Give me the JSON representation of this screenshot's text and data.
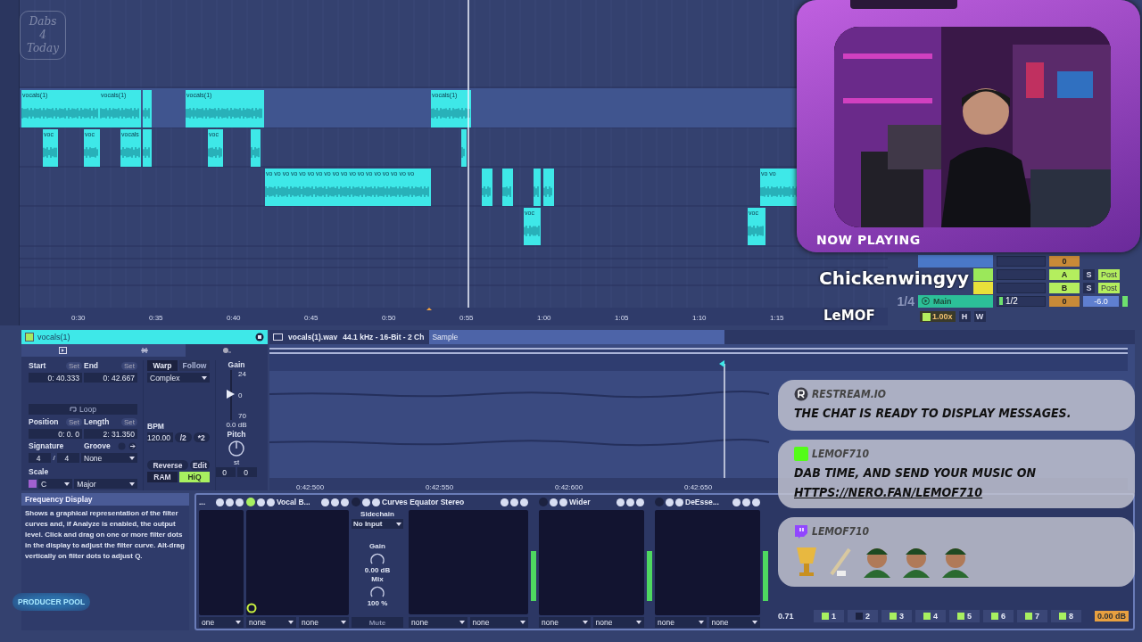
{
  "stream_logo": {
    "lines": [
      "Dabs",
      "4",
      "Today"
    ]
  },
  "arrangement": {
    "clips": [
      {
        "label": "vocals(1)"
      },
      {
        "label": "vocals(1)"
      },
      {
        "label": "vocals(1)"
      },
      {
        "label": "vocals(1)"
      },
      {
        "label": "voc"
      },
      {
        "label": "voc"
      },
      {
        "label": "vocals"
      },
      {
        "label": "voc"
      },
      {
        "label": "vo vo vo vo vo vo vo vo vo vo vo vo vo vo vo vo vo vo"
      },
      {
        "label": "vo vo"
      },
      {
        "label": "voc"
      },
      {
        "label": "voc"
      }
    ],
    "ruler": [
      "0:30",
      "0:35",
      "0:40",
      "0:45",
      "0:50",
      "0:55",
      "1:00",
      "1:05",
      "1:10",
      "1:15"
    ]
  },
  "mixer": {
    "top_value": "0",
    "sends": [
      {
        "letter": "A",
        "solo": "S",
        "mode": "Post",
        "color": "#9be85a"
      },
      {
        "letter": "B",
        "solo": "S",
        "mode": "Post",
        "color": "#e8e03a"
      }
    ],
    "main": {
      "meter": "1/4",
      "name": "Main",
      "routing": "1/2",
      "pan": "0",
      "volume": "-6.0"
    },
    "speed": {
      "value": "1.00x",
      "on": true
    },
    "buttons": [
      "H",
      "W"
    ]
  },
  "overlay": {
    "now_playing": "NOW PLAYING",
    "track": "Chickenwingyy",
    "artist": "LeMOF"
  },
  "clip": {
    "name": "vocals(1)",
    "start": {
      "label": "Start",
      "set": "Set",
      "value": "0: 40.333"
    },
    "end": {
      "label": "End",
      "set": "Set",
      "value": "0: 42.667"
    },
    "loop": {
      "label": "Loop",
      "on": false
    },
    "position": {
      "label": "Position",
      "set": "Set",
      "value": "0: 0. 0"
    },
    "length": {
      "label": "Length",
      "set": "Set",
      "value": "2: 31.350"
    },
    "signature": {
      "label": "Signature",
      "numerator": "4",
      "separator": "/",
      "denominator": "4"
    },
    "groove": {
      "label": "Groove",
      "value": "None"
    },
    "scale": {
      "label": "Scale",
      "root": "C",
      "mode": "Major"
    },
    "warp": {
      "label": "Warp",
      "on": true
    },
    "follow": {
      "label": "Follow",
      "on": false
    },
    "warp_mode": "Complex",
    "bpm": {
      "label": "BPM",
      "value": "120.00",
      "half": "/2",
      "double": "*2"
    },
    "reverse": "Reverse",
    "edit": "Edit",
    "ram": {
      "label": "RAM",
      "on": false
    },
    "hiq": {
      "label": "HiQ",
      "on": true
    },
    "gain": {
      "label": "Gain",
      "ticks": [
        "24",
        "0",
        "70"
      ],
      "value": "0.0 dB",
      "level": 0.55
    },
    "pitch": {
      "label": "Pitch",
      "unit": "st",
      "coarse": "0",
      "fine": "0"
    }
  },
  "sample": {
    "file": "vocals(1).wav",
    "format": "44.1 kHz - 16-Bit - 2 Ch",
    "tab": {
      "label": "Sample",
      "selected": true
    },
    "times": [
      "0:42:500",
      "0:42:550",
      "0:42:600",
      "0:42:650"
    ]
  },
  "info": {
    "title": "Frequency Display",
    "text": "Shows a graphical representation of the filter curves and, if Analyze is enabled, the output level. Click and drag on one or more filter dots in the display to adjust the filter curve. Alt-drag vertically on filter dots to adjust Q."
  },
  "producer_logo": "PRODUCER POOL",
  "devices": [
    {
      "kind": "plain",
      "title": "...",
      "selectors": [
        "one"
      ]
    },
    {
      "kind": "plain",
      "title": "Vocal B...",
      "on": true,
      "selectors": [
        "none",
        "none"
      ]
    },
    {
      "kind": "curves",
      "title": "Curves Equator Stereo",
      "on": false,
      "selectors": [
        "none",
        "none"
      ],
      "sidechain": {
        "label": "Sidechain",
        "input": "No Input",
        "gain_label": "Gain",
        "gain": "0.00 dB",
        "mix_label": "Mix",
        "mix": "100 %",
        "mute": "Mute"
      }
    },
    {
      "kind": "plain",
      "title": "Wider",
      "on": false,
      "selectors": [
        "none",
        "none"
      ]
    },
    {
      "kind": "plain",
      "title": "DeEsse...",
      "on": false,
      "selectors": [
        "none",
        "none"
      ]
    }
  ],
  "eq": {
    "q": "0.71",
    "bands": [
      {
        "label": "1",
        "on": true
      },
      {
        "label": "2",
        "on": false
      },
      {
        "label": "3",
        "on": true
      },
      {
        "label": "4",
        "on": true
      },
      {
        "label": "5",
        "on": true
      },
      {
        "label": "6",
        "on": true
      },
      {
        "label": "7",
        "on": true
      },
      {
        "label": "8",
        "on": true
      }
    ],
    "gain": "0.00 dB"
  },
  "chat": [
    {
      "kind": "restream",
      "user": "RESTREAM.IO",
      "message": "THE CHAT IS READY TO DISPLAY MESSAGES."
    },
    {
      "kind": "kick",
      "user": "LEMOF710",
      "message": "DAB TIME, AND SEND YOUR MUSIC ON",
      "link": "HTTPS://NERO.FAN/LEMOF710"
    },
    {
      "kind": "twitch",
      "user": "LEMOF710",
      "emotes": [
        {
          "kind": "cup"
        },
        {
          "kind": "pipe"
        },
        {
          "kind": "figure"
        },
        {
          "kind": "figure"
        },
        {
          "kind": "figure"
        }
      ]
    }
  ]
}
